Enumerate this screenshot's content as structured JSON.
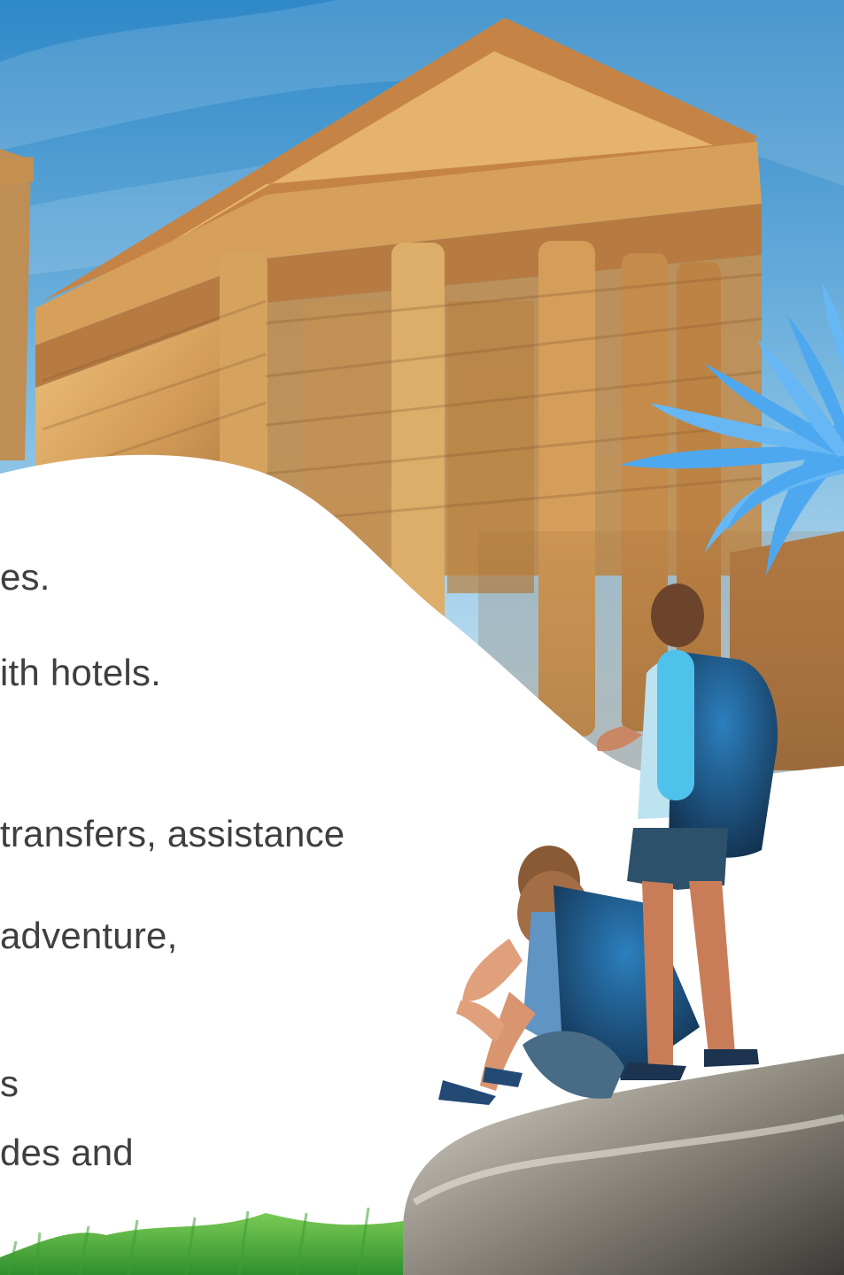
{
  "scene": {
    "image_subject": "ancient-temple-travel-banner",
    "colors": {
      "sky_top": "#2f88c8",
      "sky_mid": "#76b6df",
      "sky_light": "#d9eef8",
      "stone_light": "#e2b36b",
      "stone_mid": "#c88f4b",
      "stone_dark": "#8f6035",
      "leaf_blue": "#4ea8ef",
      "text_gray": "#3f3f3f",
      "grass_green": "#45b53f"
    }
  },
  "text_lines": [
    "es.",
    "ith hotels.",
    " transfers, assistance",
    "adventure,",
    "s",
    "des and"
  ],
  "icons": {
    "leaf": "blue-palm-leaf-icon"
  }
}
